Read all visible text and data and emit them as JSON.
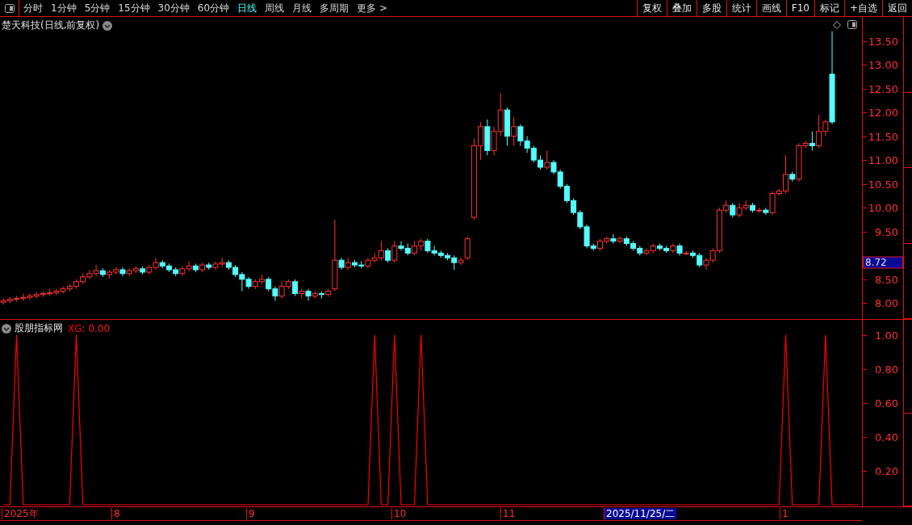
{
  "toolbar": {
    "periods": [
      {
        "label": "分时",
        "selected": false
      },
      {
        "label": "1分钟",
        "selected": false
      },
      {
        "label": "5分钟",
        "selected": false
      },
      {
        "label": "15分钟",
        "selected": false
      },
      {
        "label": "30分钟",
        "selected": false
      },
      {
        "label": "60分钟",
        "selected": false
      },
      {
        "label": "日线",
        "selected": true
      },
      {
        "label": "周线",
        "selected": false
      },
      {
        "label": "月线",
        "selected": false
      },
      {
        "label": "多周期",
        "selected": false
      },
      {
        "label": "更多 >",
        "selected": false
      }
    ],
    "actions": [
      "复权",
      "叠加",
      "多股",
      "统计",
      "画线",
      "F10",
      "标记",
      "+自选",
      "返回"
    ]
  },
  "price_panel": {
    "title": "楚天科技(日线,前复权)",
    "current_price": "8.72",
    "chart_data": {
      "type": "candlestick",
      "ylim": [
        7.65,
        14.0
      ],
      "yticks": [
        {
          "value": 13.5,
          "label": "13.50"
        },
        {
          "value": 13,
          "label": "13.00"
        },
        {
          "value": 12.5,
          "label": "12.50"
        },
        {
          "value": 12,
          "label": "12.00"
        },
        {
          "value": 11.5,
          "label": "11.50"
        },
        {
          "value": 11,
          "label": "11.00"
        },
        {
          "value": 10.5,
          "label": "10.50"
        },
        {
          "value": 10,
          "label": "10.00"
        },
        {
          "value": 9.5,
          "label": "9.50"
        },
        {
          "value": 8.5,
          "label": "8.50"
        },
        {
          "value": 8,
          "label": "8.00"
        }
      ],
      "ohlc": [
        [
          8.02,
          8.1,
          7.97,
          8.05
        ],
        [
          8.05,
          8.13,
          8.0,
          8.08
        ],
        [
          8.08,
          8.15,
          8.03,
          8.1
        ],
        [
          8.1,
          8.2,
          8.05,
          8.12
        ],
        [
          8.12,
          8.2,
          8.07,
          8.15
        ],
        [
          8.15,
          8.23,
          8.1,
          8.18
        ],
        [
          8.18,
          8.25,
          8.13,
          8.2
        ],
        [
          8.2,
          8.3,
          8.15,
          8.22
        ],
        [
          8.22,
          8.3,
          8.17,
          8.25
        ],
        [
          8.25,
          8.35,
          8.2,
          8.3
        ],
        [
          8.3,
          8.4,
          8.25,
          8.35
        ],
        [
          8.35,
          8.5,
          8.3,
          8.45
        ],
        [
          8.45,
          8.62,
          8.4,
          8.55
        ],
        [
          8.55,
          8.7,
          8.5,
          8.62
        ],
        [
          8.62,
          8.8,
          8.57,
          8.68
        ],
        [
          8.68,
          8.73,
          8.55,
          8.6
        ],
        [
          8.6,
          8.7,
          8.52,
          8.65
        ],
        [
          8.65,
          8.75,
          8.6,
          8.7
        ],
        [
          8.7,
          8.75,
          8.57,
          8.62
        ],
        [
          8.62,
          8.73,
          8.57,
          8.68
        ],
        [
          8.68,
          8.77,
          8.63,
          8.72
        ],
        [
          8.72,
          8.77,
          8.6,
          8.65
        ],
        [
          8.65,
          8.8,
          8.6,
          8.75
        ],
        [
          8.75,
          8.95,
          8.7,
          8.85
        ],
        [
          8.85,
          8.9,
          8.73,
          8.78
        ],
        [
          8.78,
          8.83,
          8.65,
          8.7
        ],
        [
          8.7,
          8.75,
          8.57,
          8.62
        ],
        [
          8.62,
          8.77,
          8.57,
          8.72
        ],
        [
          8.72,
          8.88,
          8.67,
          8.78
        ],
        [
          8.78,
          8.83,
          8.65,
          8.7
        ],
        [
          8.7,
          8.85,
          8.65,
          8.8
        ],
        [
          8.8,
          8.85,
          8.7,
          8.75
        ],
        [
          8.75,
          8.87,
          8.7,
          8.82
        ],
        [
          8.82,
          8.95,
          8.77,
          8.85
        ],
        [
          8.85,
          8.9,
          8.7,
          8.75
        ],
        [
          8.75,
          8.8,
          8.55,
          8.6
        ],
        [
          8.6,
          8.65,
          8.25,
          8.5
        ],
        [
          8.5,
          8.55,
          8.3,
          8.35
        ],
        [
          8.35,
          8.5,
          8.3,
          8.45
        ],
        [
          8.45,
          8.6,
          8.4,
          8.5
        ],
        [
          8.5,
          8.55,
          8.25,
          8.3
        ],
        [
          8.3,
          8.35,
          8.05,
          8.15
        ],
        [
          8.15,
          8.45,
          8.1,
          8.35
        ],
        [
          8.35,
          8.5,
          8.3,
          8.45
        ],
        [
          8.45,
          8.5,
          8.15,
          8.2
        ],
        [
          8.2,
          8.3,
          8.1,
          8.25
        ],
        [
          8.25,
          8.3,
          8.05,
          8.15
        ],
        [
          8.15,
          8.25,
          8.1,
          8.2
        ],
        [
          8.2,
          8.25,
          8.1,
          8.18
        ],
        [
          8.18,
          8.3,
          8.13,
          8.25
        ],
        [
          8.3,
          9.75,
          8.25,
          8.9
        ],
        [
          8.9,
          8.95,
          8.7,
          8.75
        ],
        [
          8.75,
          8.95,
          8.7,
          8.85
        ],
        [
          8.85,
          8.9,
          8.75,
          8.8
        ],
        [
          8.8,
          8.88,
          8.73,
          8.78
        ],
        [
          8.78,
          8.95,
          8.73,
          8.9
        ],
        [
          8.9,
          9.05,
          8.85,
          8.95
        ],
        [
          8.95,
          9.3,
          8.9,
          9.1
        ],
        [
          9.1,
          9.15,
          8.85,
          8.9
        ],
        [
          8.9,
          9.3,
          8.85,
          9.2
        ],
        [
          9.2,
          9.3,
          9.1,
          9.15
        ],
        [
          9.15,
          9.25,
          9.0,
          9.05
        ],
        [
          9.05,
          9.3,
          9.0,
          9.2
        ],
        [
          9.2,
          9.35,
          9.1,
          9.3
        ],
        [
          9.3,
          9.35,
          9.05,
          9.1
        ],
        [
          9.1,
          9.2,
          9.0,
          9.05
        ],
        [
          9.05,
          9.1,
          8.95,
          9.0
        ],
        [
          9.0,
          9.05,
          8.9,
          8.95
        ],
        [
          8.95,
          9.0,
          8.7,
          8.85
        ],
        [
          8.85,
          8.95,
          8.8,
          8.9
        ],
        [
          8.95,
          9.4,
          8.9,
          9.35
        ],
        [
          9.8,
          11.45,
          9.75,
          11.3
        ],
        [
          11.3,
          11.8,
          11.0,
          11.7
        ],
        [
          11.7,
          11.85,
          11.1,
          11.2
        ],
        [
          11.2,
          11.7,
          11.1,
          11.6
        ],
        [
          11.6,
          12.4,
          11.5,
          12.05
        ],
        [
          12.05,
          12.1,
          11.3,
          11.5
        ],
        [
          11.5,
          11.9,
          11.3,
          11.7
        ],
        [
          11.7,
          11.75,
          11.3,
          11.4
        ],
        [
          11.4,
          11.5,
          11.15,
          11.25
        ],
        [
          11.25,
          11.3,
          10.95,
          11.0
        ],
        [
          11.0,
          11.1,
          10.8,
          10.85
        ],
        [
          10.85,
          11.2,
          10.8,
          10.95
        ],
        [
          10.95,
          11.0,
          10.7,
          10.75
        ],
        [
          10.75,
          10.8,
          10.4,
          10.45
        ],
        [
          10.45,
          10.5,
          10.1,
          10.15
        ],
        [
          10.15,
          10.2,
          9.85,
          9.9
        ],
        [
          9.9,
          9.95,
          9.55,
          9.6
        ],
        [
          9.6,
          9.65,
          9.15,
          9.2
        ],
        [
          9.2,
          9.25,
          9.1,
          9.15
        ],
        [
          9.15,
          9.35,
          9.1,
          9.3
        ],
        [
          9.3,
          9.4,
          9.25,
          9.35
        ],
        [
          9.35,
          9.45,
          9.25,
          9.3
        ],
        [
          9.3,
          9.4,
          9.25,
          9.35
        ],
        [
          9.35,
          9.4,
          9.2,
          9.25
        ],
        [
          9.25,
          9.3,
          9.1,
          9.15
        ],
        [
          9.15,
          9.2,
          9.0,
          9.05
        ],
        [
          9.05,
          9.15,
          9.0,
          9.1
        ],
        [
          9.1,
          9.25,
          9.05,
          9.2
        ],
        [
          9.2,
          9.25,
          9.1,
          9.15
        ],
        [
          9.15,
          9.2,
          9.05,
          9.1
        ],
        [
          9.1,
          9.25,
          9.05,
          9.2
        ],
        [
          9.2,
          9.25,
          9.0,
          9.05
        ],
        [
          9.05,
          9.1,
          9.0,
          9.05
        ],
        [
          9.05,
          9.1,
          8.95,
          9.0
        ],
        [
          9.0,
          9.05,
          8.75,
          8.8
        ],
        [
          8.8,
          8.95,
          8.7,
          8.9
        ],
        [
          8.9,
          9.15,
          8.85,
          9.1
        ],
        [
          9.1,
          10.0,
          9.05,
          9.95
        ],
        [
          9.95,
          10.15,
          9.9,
          10.05
        ],
        [
          10.05,
          10.1,
          9.8,
          9.85
        ],
        [
          9.85,
          10.1,
          9.8,
          10.0
        ],
        [
          10.0,
          10.15,
          9.95,
          10.05
        ],
        [
          10.05,
          10.1,
          9.9,
          9.95
        ],
        [
          9.95,
          10.0,
          9.9,
          9.95
        ],
        [
          9.95,
          10.0,
          9.85,
          9.9
        ],
        [
          9.9,
          10.35,
          9.85,
          10.3
        ],
        [
          10.3,
          10.4,
          10.25,
          10.35
        ],
        [
          10.35,
          11.1,
          10.3,
          10.7
        ],
        [
          10.7,
          10.75,
          10.55,
          10.6
        ],
        [
          10.6,
          11.35,
          10.55,
          11.3
        ],
        [
          11.3,
          11.4,
          11.25,
          11.35
        ],
        [
          11.35,
          11.6,
          11.2,
          11.3
        ],
        [
          11.3,
          11.95,
          11.25,
          11.6
        ],
        [
          11.6,
          11.85,
          11.5,
          11.8
        ],
        [
          12.8,
          13.7,
          11.75,
          11.8
        ]
      ]
    }
  },
  "indicator_panel": {
    "name": "股朋指标网",
    "reading": ": 0.00",
    "chart_data": {
      "type": "line",
      "ylim": [
        0,
        1.09
      ],
      "yticks": [
        {
          "value": 0.2,
          "label": "0.20"
        },
        {
          "value": 0.4,
          "label": "0.40"
        },
        {
          "value": 0.6,
          "label": "0.60"
        },
        {
          "value": 0.8,
          "label": "0.80"
        },
        {
          "value": 1,
          "label": "1.00"
        }
      ],
      "series": [
        {
          "name": "XG",
          "color": "#ff0000",
          "values": [
            0,
            0,
            1,
            0,
            0,
            0,
            0,
            0,
            0,
            0,
            0,
            1,
            0,
            0,
            0,
            0,
            0,
            0,
            0,
            0,
            0,
            0,
            0,
            0,
            0,
            0,
            0,
            0,
            0,
            0,
            0,
            0,
            0,
            0,
            0,
            0,
            0,
            0,
            0,
            0,
            0,
            0,
            0,
            0,
            0,
            0,
            0,
            0,
            0,
            0,
            0,
            0,
            0,
            0,
            0,
            0,
            1,
            0,
            0,
            1,
            0,
            0,
            0,
            1,
            0,
            0,
            0,
            0,
            0,
            0,
            0,
            0,
            0,
            0,
            0,
            0,
            0,
            0,
            0,
            0,
            0,
            0,
            0,
            0,
            0,
            0,
            0,
            0,
            0,
            0,
            0,
            0,
            0,
            0,
            0,
            0,
            0,
            0,
            0,
            0,
            0,
            0,
            0,
            0,
            0,
            0,
            0,
            0,
            0,
            0,
            0,
            0,
            0,
            0,
            0,
            0,
            0,
            0,
            1,
            0,
            0,
            0,
            0,
            0,
            1,
            0,
            0,
            0,
            0,
            0
          ]
        }
      ]
    }
  },
  "date_axis": {
    "labels": [
      {
        "text": "2025年",
        "selected": false
      },
      {
        "text": "8",
        "selected": false
      },
      {
        "text": "9",
        "selected": false
      },
      {
        "text": "10",
        "selected": false
      },
      {
        "text": "11",
        "selected": false
      },
      {
        "text": "2025/11/25/二",
        "selected": true
      },
      {
        "text": "1",
        "selected": false
      }
    ]
  }
}
